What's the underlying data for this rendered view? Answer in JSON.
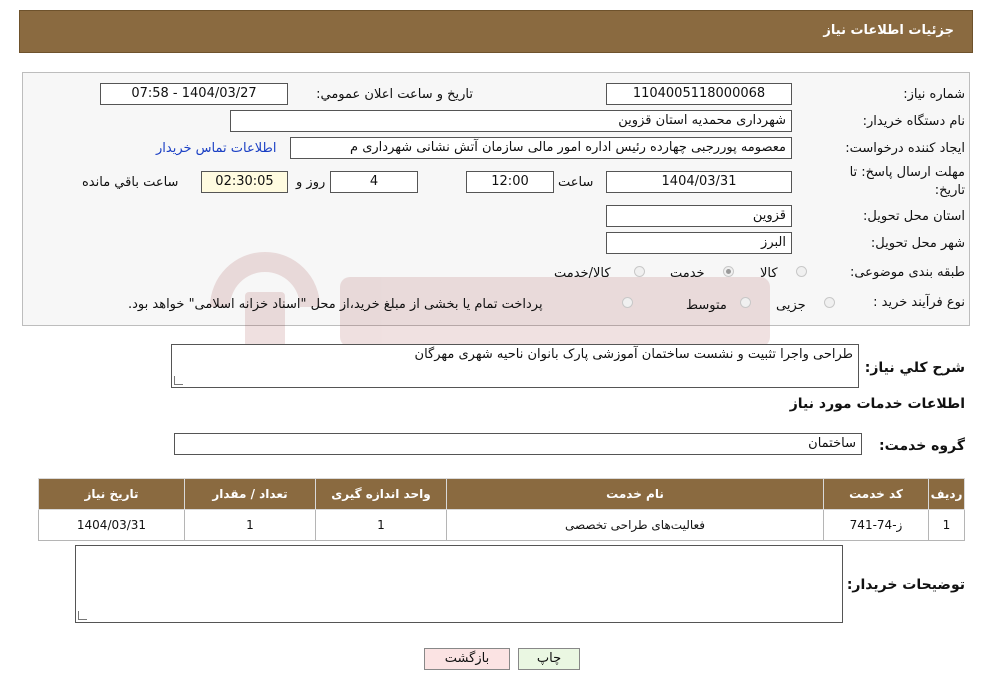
{
  "header": {
    "title": "جزئیات اطلاعات نیاز"
  },
  "form": {
    "need_number_label": "شماره نیاز:",
    "need_number": "1104005118000068",
    "announce_label": "تاریخ و ساعت اعلان عمومي:",
    "announce_value": "1404/03/27 - 07:58",
    "buyer_org_label": "نام دستگاه خريدار:",
    "buyer_org": "شهرداری محمدیه استان قزوین",
    "creator_label": "ايجاد کننده درخواست:",
    "creator": "معصومه پوررجبی چهارده رئیس اداره امور مالی سازمان آتش نشانی شهرداری م",
    "contact_link": "اطلاعات تماس خريدار",
    "deadline_label_1": "مهلت ارسال پاسخ: تا",
    "deadline_label_2": "تاريخ:",
    "deadline_date": "1404/03/31",
    "time_label": "ساعت",
    "deadline_time": "12:00",
    "days": "4",
    "days_label": "روز و",
    "remaining": "02:30:05",
    "remaining_label": "ساعت باقي مانده",
    "province_label": "استان محل تحويل:",
    "province": "قزوین",
    "city_label": "شهر محل تحويل:",
    "city": "البرز",
    "category_label": "طبقه بندی موضوعی:",
    "category_options": [
      "کالا",
      "خدمت",
      "کالا/خدمت"
    ],
    "process_label": "نوع فرآیند خرید :",
    "process_options": [
      "جزیی",
      "متوسط"
    ],
    "process_note": "پرداخت تمام يا بخشی از مبلغ خريد،از محل \"اسناد خزانه اسلامی\" خواهد بود."
  },
  "description": {
    "label": "شرح کلي نياز:",
    "value": "طراحی واجرا تثبیت و نشست ساختمان آموزشی پارک بانوان ناحیه شهری مهرگان"
  },
  "services": {
    "title": "اطلاعات خدمات مورد نياز",
    "group_label": "گروه خدمت:",
    "group_value": "ساختمان",
    "columns": [
      "رديف",
      "کد خدمت",
      "نام خدمت",
      "واحد اندازه گيری",
      "تعداد / مقدار",
      "تاريخ نياز"
    ],
    "rows": [
      {
        "row": "1",
        "code": "ز-74-741",
        "name": "فعاليت‌های طراحی تخصصی",
        "unit": "1",
        "qty": "1",
        "date": "1404/03/31"
      }
    ]
  },
  "buyer_notes": {
    "label": "توضيحات خريدار:",
    "value": ""
  },
  "buttons": {
    "print": "چاپ",
    "back": "بازگشت"
  },
  "colors": {
    "header": "#8a6a40",
    "print_button": "#eaf7e2",
    "back_button": "#fbe3e3",
    "link": "#1a3fc4"
  }
}
